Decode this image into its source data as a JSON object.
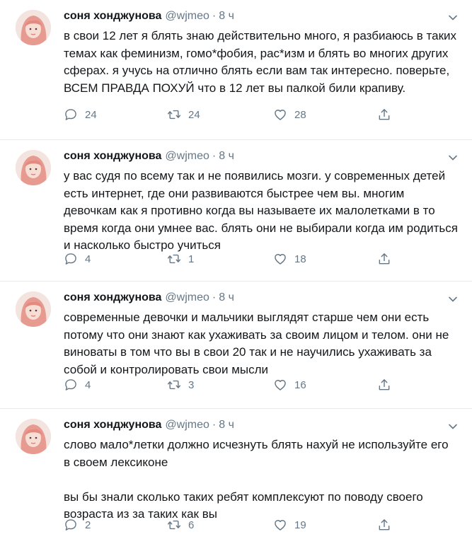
{
  "tweets": [
    {
      "name": "соня хонджунова",
      "handle": "@wjmeo",
      "separator": "·",
      "time": "8 ч",
      "text": "в свои 12 лет я блять знаю действительно много, я разбиаюсь в таких темах как феминизм, гомо*фобия, рас*изм и блять во многих других сферах. я учусь на отлично блять если вам так интересно. поверьте, ВСЕМ ПРАВДА ПОХУЙ что в 12 лет вы палкой били крапиву.",
      "replies": "24",
      "retweets": "24",
      "likes": "28"
    },
    {
      "name": "соня хонджунова",
      "handle": "@wjmeo",
      "separator": "·",
      "time": "8 ч",
      "text": "у вас судя по всему так и не появились мозги. у современных детей есть интернет, где они развиваются быстрее чем вы. многим девочкам как я противно когда вы называете их малолетками в то время когда они умнее вас. блять они не выбирали когда им родиться и насколько быстро учиться",
      "replies": "4",
      "retweets": "1",
      "likes": "18"
    },
    {
      "name": "соня хонджунова",
      "handle": "@wjmeo",
      "separator": "·",
      "time": "8 ч",
      "text": "современные девочки и мальчики выглядят старше чем они есть потому что они знают как ухаживать за своим лицом и телом. они не виноваты в том что вы в свои 20 так и не научились ухаживать за собой и контролировать свои мысли",
      "replies": "4",
      "retweets": "3",
      "likes": "16"
    },
    {
      "name": "соня хонджунова",
      "handle": "@wjmeo",
      "separator": "·",
      "time": "8 ч",
      "text": "слово мало*летки должно исчезнуть блять нахуй не используйте его в своем лексиконе\n\nвы бы знали сколько таких ребят комплексуют по поводу своего возраста из за таких как вы",
      "replies": "2",
      "retweets": "6",
      "likes": "19"
    }
  ],
  "icons": {
    "reply": "speech-bubble",
    "retweet": "retweet-arrows",
    "like": "heart",
    "share": "share-upload",
    "caret": "chevron-down"
  },
  "colors": {
    "muted": "#657786",
    "text": "#14171a",
    "divider": "#e6ecf0"
  }
}
